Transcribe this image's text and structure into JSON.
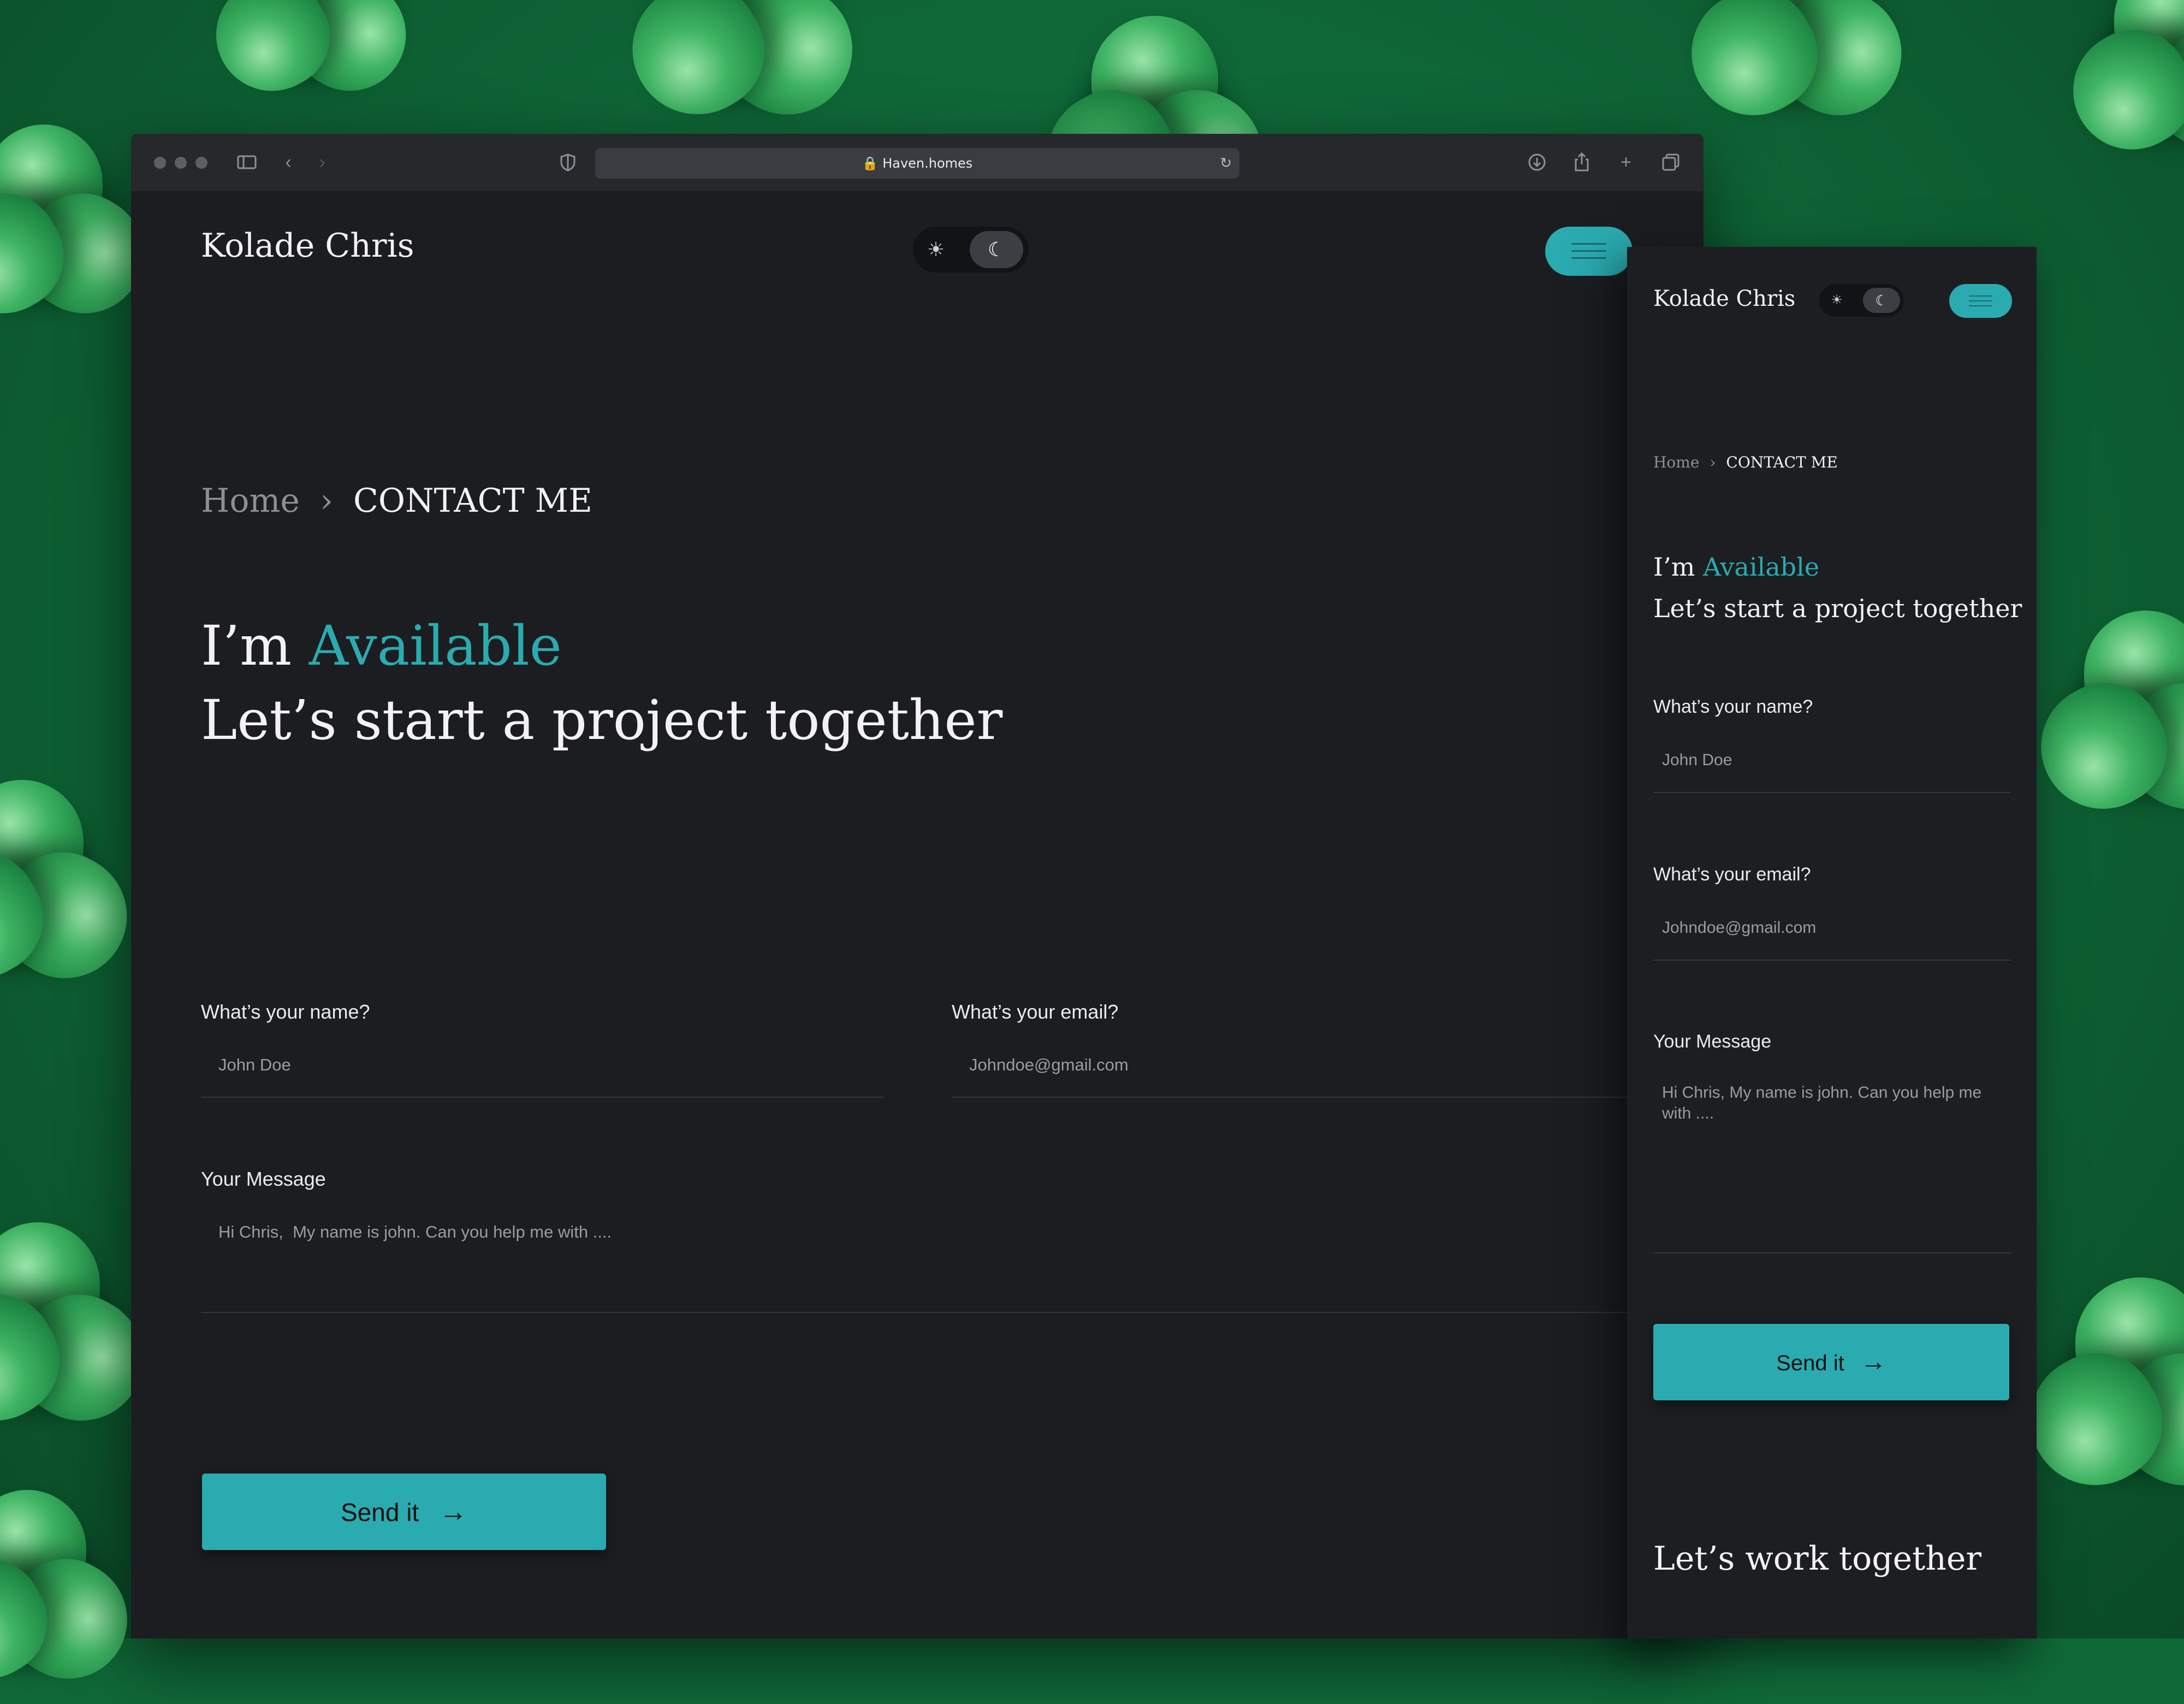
{
  "browser": {
    "url": "Haven.homes",
    "lock_icon": "lock-icon",
    "reload_icon": "reload-icon"
  },
  "desktop": {
    "logo": "Kolade Chris",
    "breadcrumb": {
      "home": "Home",
      "separator": "›",
      "current": "CONTACT ME"
    },
    "headline": {
      "prefix": "I’m ",
      "accent": "Available",
      "line2": "Let’s start a project together"
    },
    "form": {
      "name_label": "What’s your name?",
      "name_placeholder": "John Doe",
      "email_label": "What’s your email?",
      "email_placeholder": "Johndoe@gmail.com",
      "message_label": "Your Message",
      "message_placeholder": "Hi Chris,  My name is john. Can you help me with ....",
      "submit_label": "Send it",
      "submit_arrow": "→"
    }
  },
  "mobile": {
    "logo": "Kolade Chris",
    "breadcrumb": {
      "home": "Home",
      "separator": "›",
      "current": "CONTACT ME"
    },
    "headline": {
      "prefix": "I’m ",
      "accent": "Available",
      "line2": "Let’s start a project together"
    },
    "form": {
      "name_label": "What’s your name?",
      "name_placeholder": "John Doe",
      "email_label": "What’s your email?",
      "email_placeholder": "Johndoe@gmail.com",
      "message_label": "Your Message",
      "message_placeholder": "Hi Chris,  My name is john. Can you help me with ....",
      "submit_label": "Send it",
      "submit_arrow": "→"
    },
    "footer_heading": "Let’s work together"
  },
  "theme": {
    "accent": "#2aabb0",
    "background": "#1b1d21",
    "backdrop": "#106838"
  }
}
